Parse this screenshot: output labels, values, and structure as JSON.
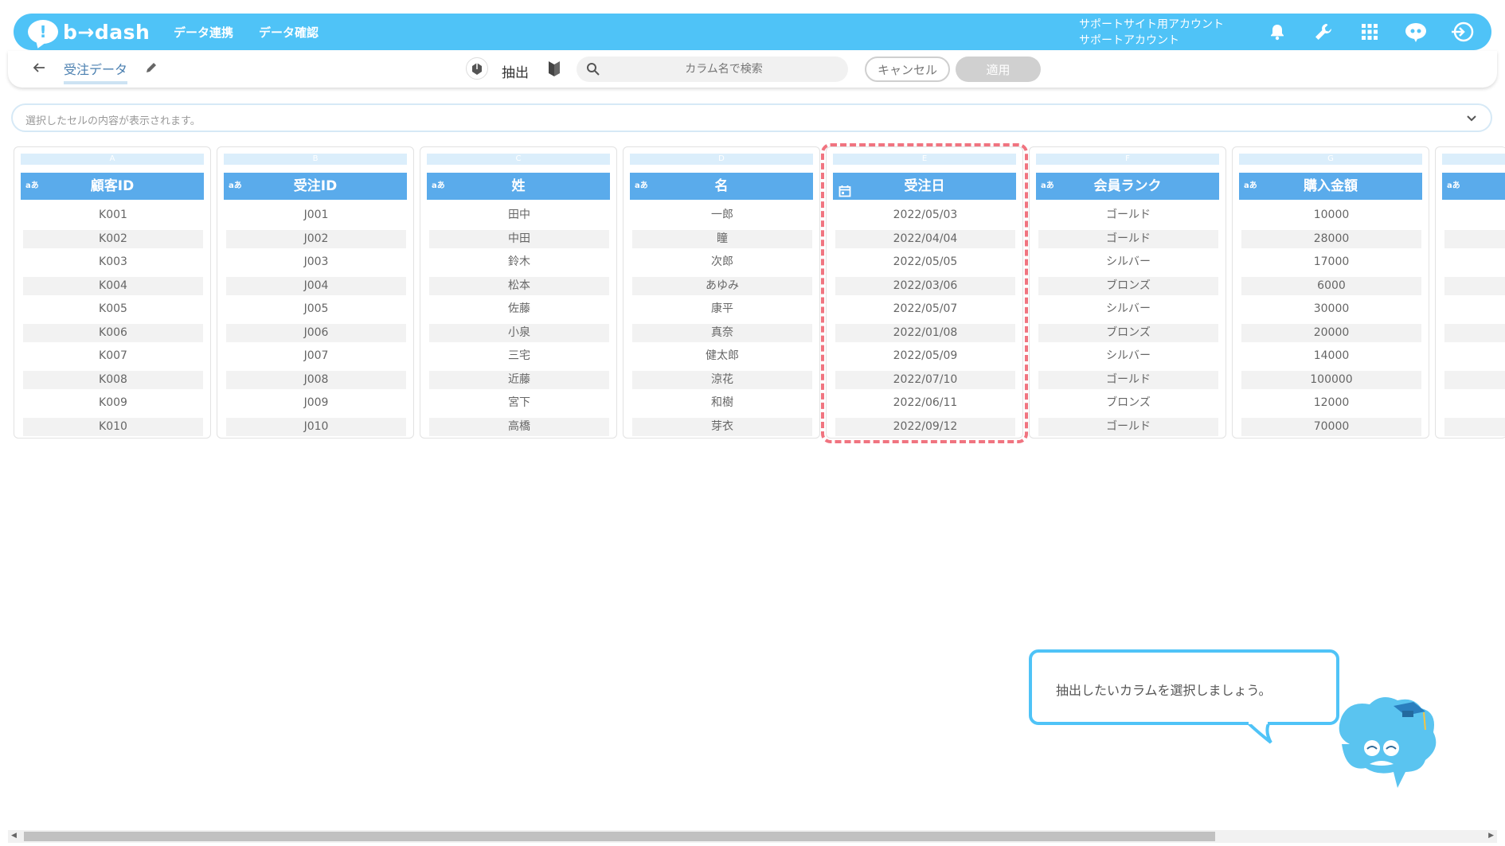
{
  "header": {
    "logo_text": "b→dash",
    "nav": [
      "データ連携",
      "データ確認"
    ],
    "account_line1": "サポートサイト用アカウント",
    "account_line2": "サポートアカウント"
  },
  "toolbar": {
    "tab_title": "受注データ",
    "extract_label": "抽出",
    "search_placeholder": "カラム名で検索",
    "cancel_label": "キャンセル",
    "apply_label": "適用"
  },
  "cell_bar": {
    "placeholder": "選択したセルの内容が表示されます。"
  },
  "columns": [
    {
      "letter": "A",
      "type": "aあ",
      "name": "顧客ID",
      "values": [
        "K001",
        "K002",
        "K003",
        "K004",
        "K005",
        "K006",
        "K007",
        "K008",
        "K009",
        "K010"
      ]
    },
    {
      "letter": "B",
      "type": "aあ",
      "name": "受注ID",
      "values": [
        "J001",
        "J002",
        "J003",
        "J004",
        "J005",
        "J006",
        "J007",
        "J008",
        "J009",
        "J010"
      ]
    },
    {
      "letter": "C",
      "type": "aあ",
      "name": "姓",
      "values": [
        "田中",
        "中田",
        "鈴木",
        "松本",
        "佐藤",
        "小泉",
        "三宅",
        "近藤",
        "宮下",
        "高橋"
      ]
    },
    {
      "letter": "D",
      "type": "aあ",
      "name": "名",
      "values": [
        "一郎",
        "瞳",
        "次郎",
        "あゆみ",
        "康平",
        "真奈",
        "健太郎",
        "涼花",
        "和樹",
        "芽衣"
      ]
    },
    {
      "letter": "E",
      "type": "calendar",
      "name": "受注日",
      "values": [
        "2022/05/03",
        "2022/04/04",
        "2022/05/05",
        "2022/03/06",
        "2022/05/07",
        "2022/01/08",
        "2022/05/09",
        "2022/07/10",
        "2022/06/11",
        "2022/09/12"
      ]
    },
    {
      "letter": "F",
      "type": "aあ",
      "name": "会員ランク",
      "values": [
        "ゴールド",
        "ゴールド",
        "シルバー",
        "ブロンズ",
        "シルバー",
        "ブロンズ",
        "シルバー",
        "ゴールド",
        "ブロンズ",
        "ゴールド"
      ]
    },
    {
      "letter": "G",
      "type": "aあ",
      "name": "購入金額",
      "values": [
        "10000",
        "28000",
        "17000",
        "6000",
        "30000",
        "20000",
        "14000",
        "100000",
        "12000",
        "70000"
      ]
    }
  ],
  "partial_column": {
    "type": "aあ"
  },
  "tooltip": {
    "text": "抽出したいカラムを選択しましょう。"
  },
  "colors": {
    "brand": "#4fc3f7",
    "header": "#5aabeb",
    "highlight": "#f07480"
  }
}
